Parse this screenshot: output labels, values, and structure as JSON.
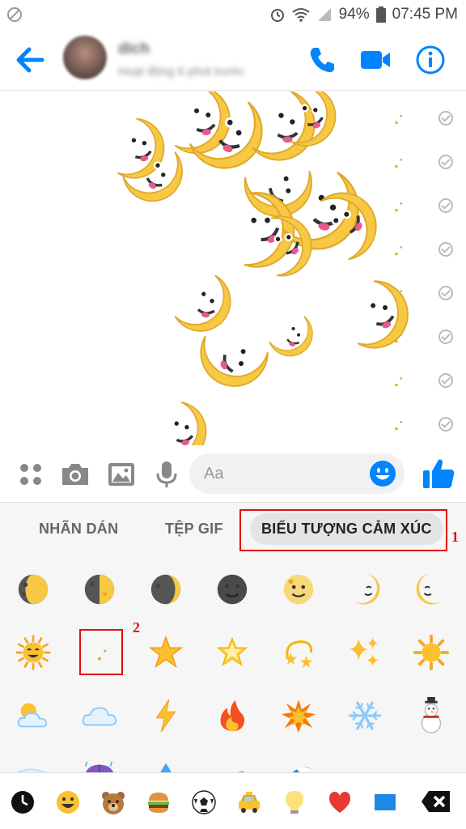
{
  "status": {
    "battery": "94%",
    "time": "07:45 PM"
  },
  "header": {
    "name": "dich",
    "subtitle": "Hoạt động 6 phút trước"
  },
  "composer": {
    "placeholder": "Aa"
  },
  "tabs": [
    "NHÃN DÁN",
    "TỆP GIF",
    "BIỂU TƯỢNG CẢM XÚC"
  ],
  "active_tab": 2,
  "annotations": {
    "tab_marker": "1",
    "emoji_marker": "2"
  },
  "emoji_grid": [
    [
      "waning-gibbous-moon-icon",
      "last-quarter-moon-icon",
      "waning-crescent-moon-icon",
      "new-moon-face-icon",
      "full-moon-face-icon",
      "first-quarter-moon-face-icon",
      "last-quarter-moon-face-icon"
    ],
    [
      "sun-with-face-icon",
      "crescent-moon-icon",
      "star-icon",
      "glowing-star-icon",
      "dizzy-icon",
      "sparkles-icon",
      "sun-icon"
    ],
    [
      "sun-behind-cloud-icon",
      "cloud-icon",
      "lightning-icon",
      "fire-icon",
      "collision-icon",
      "snowflake-icon",
      "snowman-icon"
    ],
    [
      "wind-face-icon",
      "umbrella-rain-icon",
      "droplet-icon",
      "splashing-sweat-icon",
      "water-wave-icon"
    ]
  ],
  "categories": [
    "recent-icon",
    "smiley-icon",
    "bear-icon",
    "burger-icon",
    "soccer-ball-icon",
    "taxi-icon",
    "light-bulb-icon",
    "heart-icon",
    "flag-icon"
  ],
  "colors": {
    "messenger_blue": "#0084ff",
    "highlight_red": "#d11111",
    "moon_yellow": "#f7c843"
  }
}
